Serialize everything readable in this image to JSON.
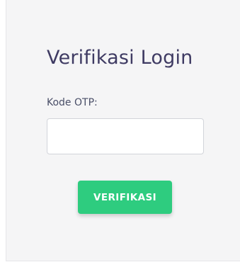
{
  "form": {
    "title": "Verifikasi Login",
    "otp_label": "Kode OTP:",
    "otp_value": "",
    "otp_placeholder": "",
    "submit_label": "VERIFIKASI"
  },
  "colors": {
    "card_background": "#f5f5f6",
    "title": "#3f3b63",
    "button": "#2ecc7f",
    "button_text": "#ffffff"
  }
}
